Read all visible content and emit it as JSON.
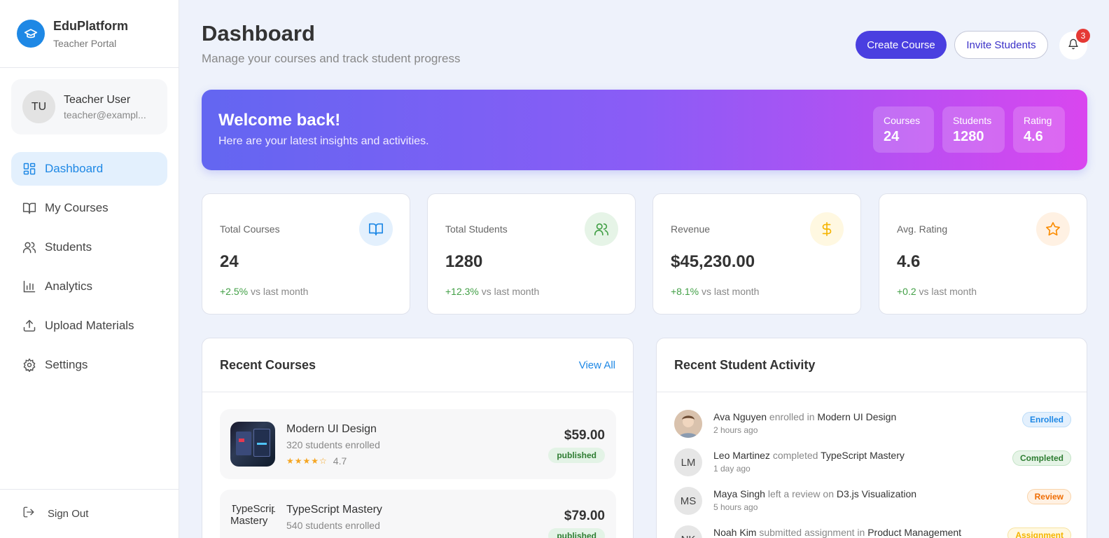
{
  "brand": {
    "name": "EduPlatform",
    "subtitle": "Teacher Portal"
  },
  "user": {
    "initials": "TU",
    "name": "Teacher User",
    "email": "teacher@exampl..."
  },
  "nav": [
    {
      "label": "Dashboard",
      "icon": "dashboard-icon",
      "active": true
    },
    {
      "label": "My Courses",
      "icon": "book-icon",
      "active": false
    },
    {
      "label": "Students",
      "icon": "users-icon",
      "active": false
    },
    {
      "label": "Analytics",
      "icon": "bar-chart-icon",
      "active": false
    },
    {
      "label": "Upload Materials",
      "icon": "upload-icon",
      "active": false
    },
    {
      "label": "Settings",
      "icon": "gear-icon",
      "active": false
    }
  ],
  "signout_label": "Sign Out",
  "header": {
    "title": "Dashboard",
    "subtitle": "Manage your courses and track student progress",
    "create_label": "Create Course",
    "invite_label": "Invite Students",
    "notification_count": "3"
  },
  "welcome": {
    "title": "Welcome back!",
    "subtitle": "Here are your latest insights and activities.",
    "stats": [
      {
        "label": "Courses",
        "value": "24"
      },
      {
        "label": "Students",
        "value": "1280"
      },
      {
        "label": "Rating",
        "value": "4.6"
      }
    ]
  },
  "stat_cards": [
    {
      "label": "Total Courses",
      "value": "24",
      "change": "+2.5%",
      "suffix": "vs last month",
      "icon": "book-open-icon",
      "icon_bg": "#e3f0fd",
      "icon_color": "#1e88e5"
    },
    {
      "label": "Total Students",
      "value": "1280",
      "change": "+12.3%",
      "suffix": "vs last month",
      "icon": "users-icon",
      "icon_bg": "#e6f4e7",
      "icon_color": "#43a047"
    },
    {
      "label": "Revenue",
      "value": "$45,230.00",
      "change": "+8.1%",
      "suffix": "vs last month",
      "icon": "dollar-icon",
      "icon_bg": "#fff8e1",
      "icon_color": "#f5b400"
    },
    {
      "label": "Avg. Rating",
      "value": "4.6",
      "change": "+0.2",
      "suffix": "vs last month",
      "icon": "star-icon",
      "icon_bg": "#fff1e3",
      "icon_color": "#fb8c00"
    }
  ],
  "recent_courses": {
    "title": "Recent Courses",
    "view_all": "View All",
    "items": [
      {
        "name": "Modern UI Design",
        "enrolled": "320 students enrolled",
        "rating": "4.7",
        "price": "$59.00",
        "status": "published",
        "thumb_alt": ""
      },
      {
        "name": "TypeScript Mastery",
        "enrolled": "540 students enrolled",
        "rating": "",
        "price": "$79.00",
        "status": "published",
        "thumb_alt": "TypeScript Mastery"
      }
    ]
  },
  "activity": {
    "title": "Recent Student Activity",
    "items": [
      {
        "initials": "",
        "name": "Ava Nguyen",
        "verb": "enrolled in",
        "target": "Modern UI Design",
        "time": "2 hours ago",
        "badge": "Enrolled",
        "badge_bg": "#e3f0fd",
        "badge_color": "#1e88e5",
        "badge_border": "#bcdcf8"
      },
      {
        "initials": "LM",
        "name": "Leo Martinez",
        "verb": "completed",
        "target": "TypeScript Mastery",
        "time": "1 day ago",
        "badge": "Completed",
        "badge_bg": "#e6f4e7",
        "badge_color": "#2e7d32",
        "badge_border": "#c3e3c6"
      },
      {
        "initials": "MS",
        "name": "Maya Singh",
        "verb": "left a review on",
        "target": "D3.js Visualization",
        "time": "5 hours ago",
        "badge": "Review",
        "badge_bg": "#fff1e3",
        "badge_color": "#ef6c00",
        "badge_border": "#f9d3a9"
      },
      {
        "initials": "NK",
        "name": "Noah Kim",
        "verb": "submitted assignment in",
        "target": "Product Management",
        "time": "",
        "badge": "Assignment",
        "badge_bg": "#fff8e1",
        "badge_color": "#f5b400",
        "badge_border": "#f7e3a0"
      }
    ]
  }
}
